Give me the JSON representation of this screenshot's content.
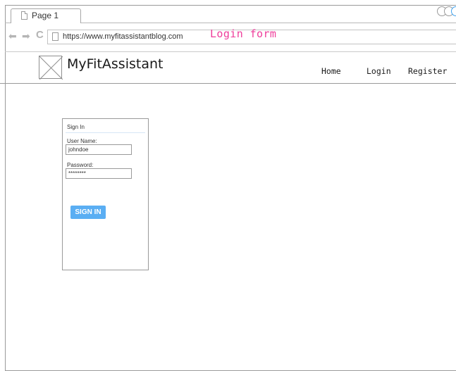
{
  "browser": {
    "tab_label": "Page 1",
    "url": "https://www.myfitassistantblog.com",
    "nav_back_glyph": "⬅",
    "nav_forward_glyph": "➡",
    "nav_reload_glyph": "C"
  },
  "annotation": "Login form",
  "site": {
    "title": "MyFitAssistant",
    "nav": {
      "home": "Home",
      "login": "Login",
      "register": "Register"
    }
  },
  "signin": {
    "title": "Sign In",
    "username_label": "User Name:",
    "username_value": "johndoe",
    "password_label": "Password:",
    "password_value": "********",
    "button_label": "SIGN IN"
  },
  "colors": {
    "annotation": "#ee3c9a",
    "button": "#5aaef3",
    "window_circle_accent": "#3fa3f0"
  }
}
